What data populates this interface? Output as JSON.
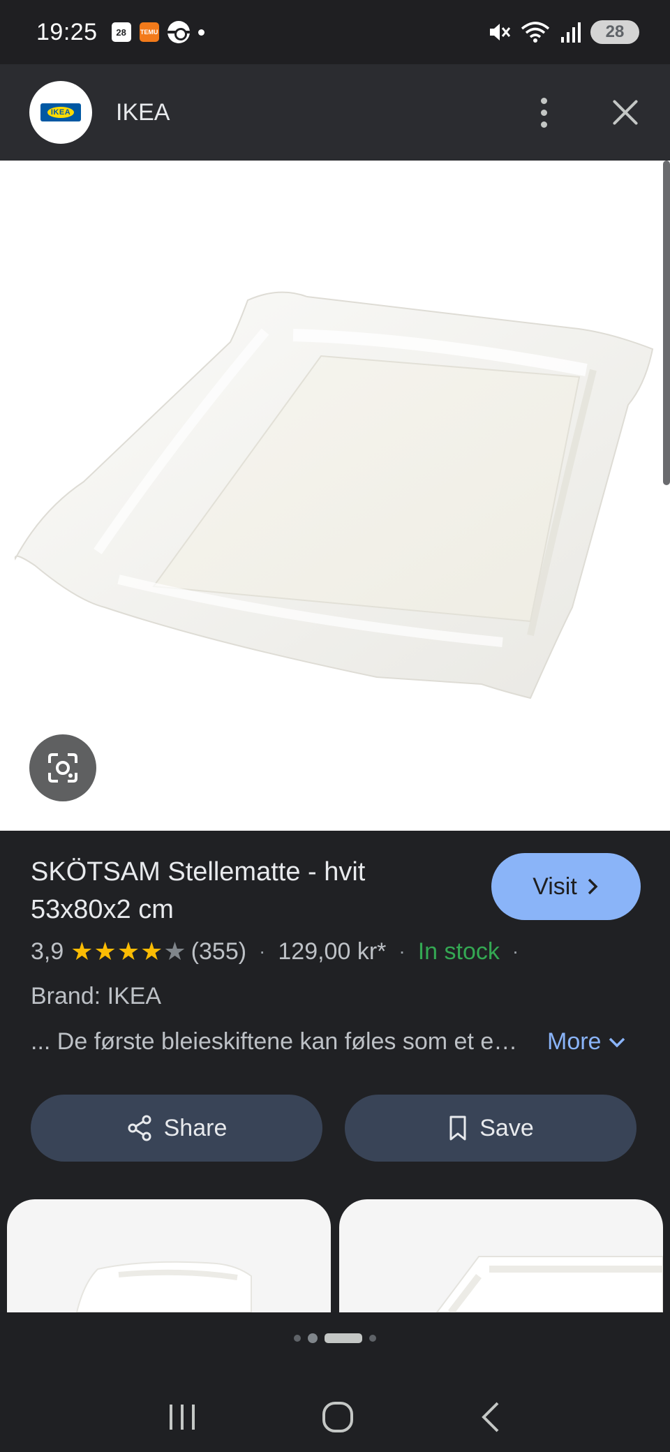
{
  "status_bar": {
    "time": "19:25",
    "calendar_badge": "28",
    "temu_label": "TEMU",
    "battery": "28",
    "icons": [
      "calendar-icon",
      "temu-icon",
      "pokeball-icon",
      "notification-dot-icon",
      "mute-icon",
      "wifi-icon",
      "signal-icon",
      "battery-icon"
    ]
  },
  "header": {
    "site_name": "IKEA",
    "logo_text": "IKEA"
  },
  "product": {
    "title": "SKÖTSAM Stellematte - hvit 53x80x2 cm",
    "visit_label": "Visit",
    "rating": "3,9",
    "rating_value": 3.9,
    "review_count": "(355)",
    "price": "129,00 kr*",
    "stock": "In stock",
    "brand": "Brand: IKEA",
    "description": "... De første bleieskiftene kan føles som et eventyr",
    "more_label": "More",
    "share_label": "Share",
    "save_label": "Save"
  },
  "pager": {
    "total": 4,
    "active_index": 2
  },
  "colors": {
    "accent_blue": "#8ab4f8",
    "in_stock_green": "#34a853",
    "star_yellow": "#fbbc04",
    "button_bg": "#394457"
  }
}
